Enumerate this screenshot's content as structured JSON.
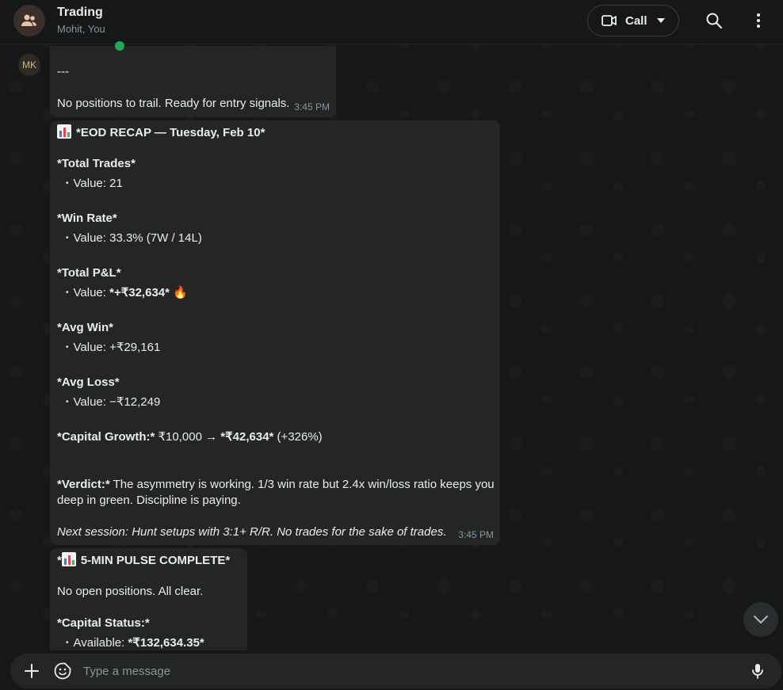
{
  "header": {
    "title": "Trading",
    "subtitle": "Mohit, You",
    "call_label": "Call"
  },
  "sender_initials": "MK",
  "messages": [
    {
      "separator": "---",
      "text": "No positions to trail. Ready for entry signals.",
      "time": "3:45 PM"
    },
    {
      "title": "*EOD RECAP — Tuesday, Feb 10*",
      "stats": [
        {
          "label": "*Total Trades*",
          "value_prefix": "Value: ",
          "value": "21"
        },
        {
          "label": "*Win Rate*",
          "value_prefix": "Value: ",
          "value": "33.3% (7W / 14L)"
        },
        {
          "label": "*Total P&L*",
          "value_prefix": "Value: ",
          "value": "*+₹32,634*",
          "emoji": "🔥"
        },
        {
          "label": "*Avg Win*",
          "value_prefix": "Value: ",
          "value": "+₹29,161"
        },
        {
          "label": "*Avg Loss*",
          "value_prefix": "Value: ",
          "value": "−₹12,249"
        }
      ],
      "growth_label": "*Capital Growth:*",
      "growth_from": " ₹10,000 → ",
      "growth_to": "*₹42,634*",
      "growth_pct": " (+326%)",
      "verdict_label": "*Verdict:*",
      "verdict_line1": " The asymmetry is working. 1/3 win rate but 2.4x win/loss ratio keeps you",
      "verdict_line2": "deep in green. Discipline is paying.",
      "next_session": "Next session: Hunt setups with 3:1+ R/R. No trades for the sake of trades.",
      "time": "3:45 PM"
    },
    {
      "title_prefix": "*",
      "title": "5-MIN PULSE COMPLETE*",
      "text": "No open positions. All clear.",
      "capital_label": "*Capital Status:*",
      "available_prefix": "Available: ",
      "available_value": "*₹132,634.35*"
    }
  ],
  "composer": {
    "placeholder": "Type a message"
  },
  "icons": [
    "group-icon",
    "video-icon",
    "chevron-down-icon",
    "search-icon",
    "more-icon",
    "plus-icon",
    "sticker-icon",
    "mic-icon",
    "chart-emoji-icon",
    "fire-emoji-icon",
    "scroll-down-icon"
  ]
}
